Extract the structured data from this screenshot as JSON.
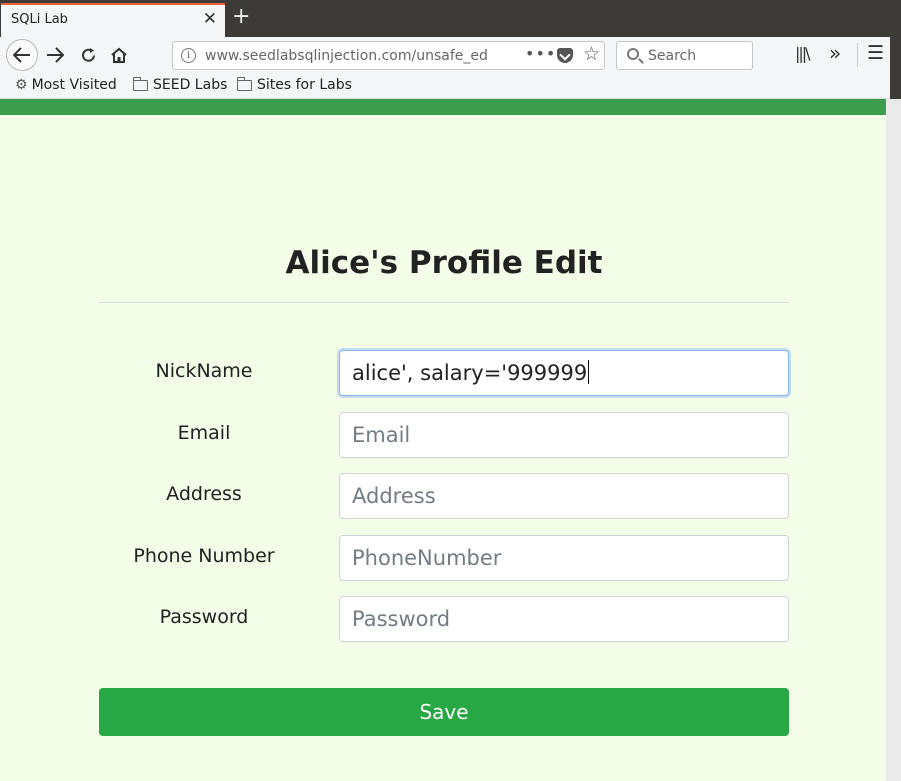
{
  "browser": {
    "tab_title": "SQLi Lab",
    "url": "www.seedlabsqlinjection.com/unsafe_ed",
    "search_placeholder": "Search",
    "bookmarks": [
      "Most Visited",
      "SEED Labs",
      "Sites for Labs"
    ]
  },
  "page": {
    "heading": "Alice's Profile Edit",
    "fields": [
      {
        "label": "NickName",
        "value": "alice', salary='999999",
        "placeholder": ""
      },
      {
        "label": "Email",
        "value": "",
        "placeholder": "Email"
      },
      {
        "label": "Address",
        "value": "",
        "placeholder": "Address"
      },
      {
        "label": "Phone Number",
        "value": "",
        "placeholder": "PhoneNumber"
      },
      {
        "label": "Password",
        "value": "",
        "placeholder": "Password"
      }
    ],
    "save_label": "Save"
  },
  "colors": {
    "page_bg": "#f3fde8",
    "top_bar": "#3c9d4e",
    "save_button": "#28a745"
  }
}
